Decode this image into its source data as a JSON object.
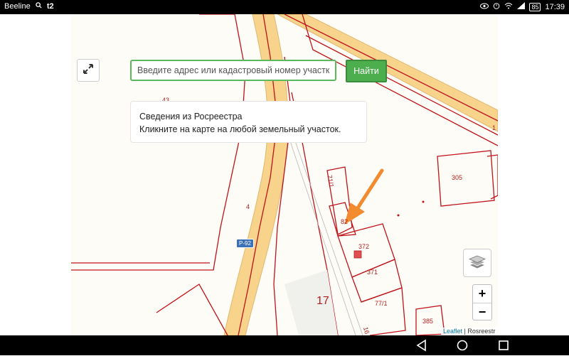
{
  "statusbar": {
    "carrier": "Beeline",
    "carrier2": "t2",
    "battery": "85",
    "time": "17:39"
  },
  "map": {
    "parcels": [
      "43",
      "4",
      "71/1",
      "82",
      "372",
      "371",
      "77/1",
      "305",
      "385",
      "1",
      "16"
    ],
    "big_label": "17",
    "road_shield": "P-92",
    "accent_parcel": "#c0121b",
    "road_fill": "#f7d38b"
  },
  "search": {
    "placeholder": "Введите адрес или кадастровый номер участка",
    "button_label": "Найти"
  },
  "info": {
    "title": "Сведения из Росреестра",
    "hint": "Кликните на карте на любой земельный участок."
  },
  "controls": {
    "zoom_in": "+",
    "zoom_out": "−"
  },
  "attribution": {
    "leaflet": "Leaflet",
    "separator": " | ",
    "source": "Rosreestr"
  },
  "annotation_color": "#f28a30"
}
